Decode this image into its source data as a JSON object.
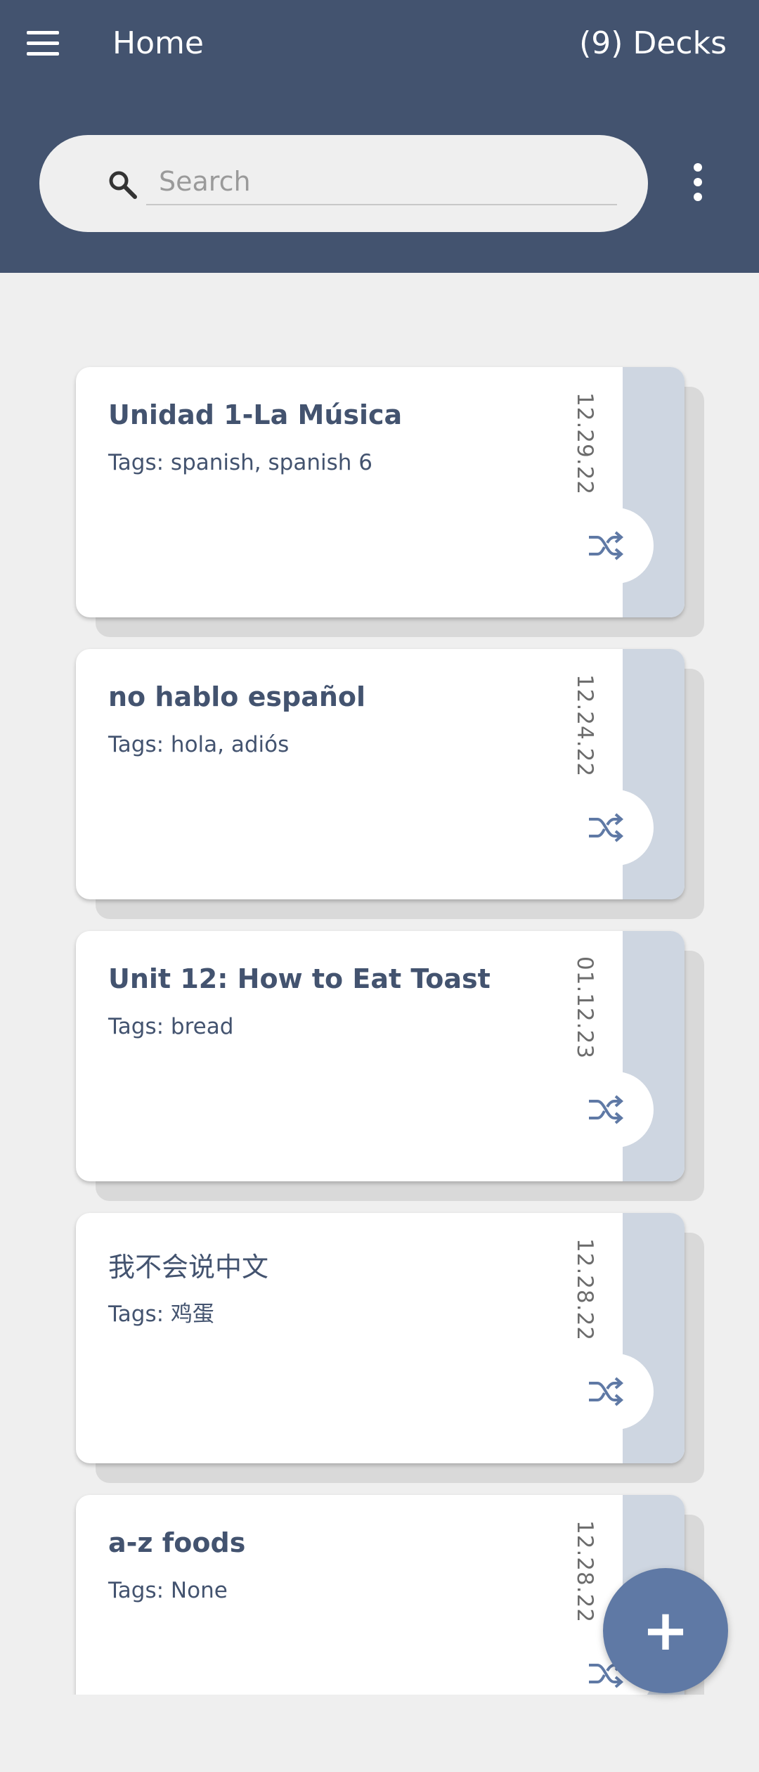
{
  "header": {
    "title": "Home",
    "deck_count": "(9) Decks"
  },
  "search": {
    "placeholder": "Search",
    "value": ""
  },
  "decks": [
    {
      "title": "Unidad 1-La Música",
      "tags": "Tags: spanish, spanish 6",
      "date": "12.29.22"
    },
    {
      "title": "no hablo español",
      "tags": "Tags: hola, adiós",
      "date": "12.24.22"
    },
    {
      "title": "Unit 12: How to Eat Toast",
      "tags": "Tags: bread",
      "date": "01.12.23"
    },
    {
      "title": "我不会说中文",
      "tags": "Tags: 鸡蛋",
      "date": "12.28.22"
    },
    {
      "title": "a-z foods",
      "tags": "Tags: None",
      "date": "12.28.22"
    }
  ],
  "fab": {
    "label": "+"
  },
  "colors": {
    "header_bg": "#43536f",
    "accent": "#5f79a5",
    "card_side": "#ced6e1",
    "text_primary": "#43536f"
  },
  "icons": {
    "menu": "menu-icon",
    "search": "search-icon",
    "more": "more-vert-icon",
    "shuffle": "shuffle-icon",
    "add": "add-icon"
  }
}
